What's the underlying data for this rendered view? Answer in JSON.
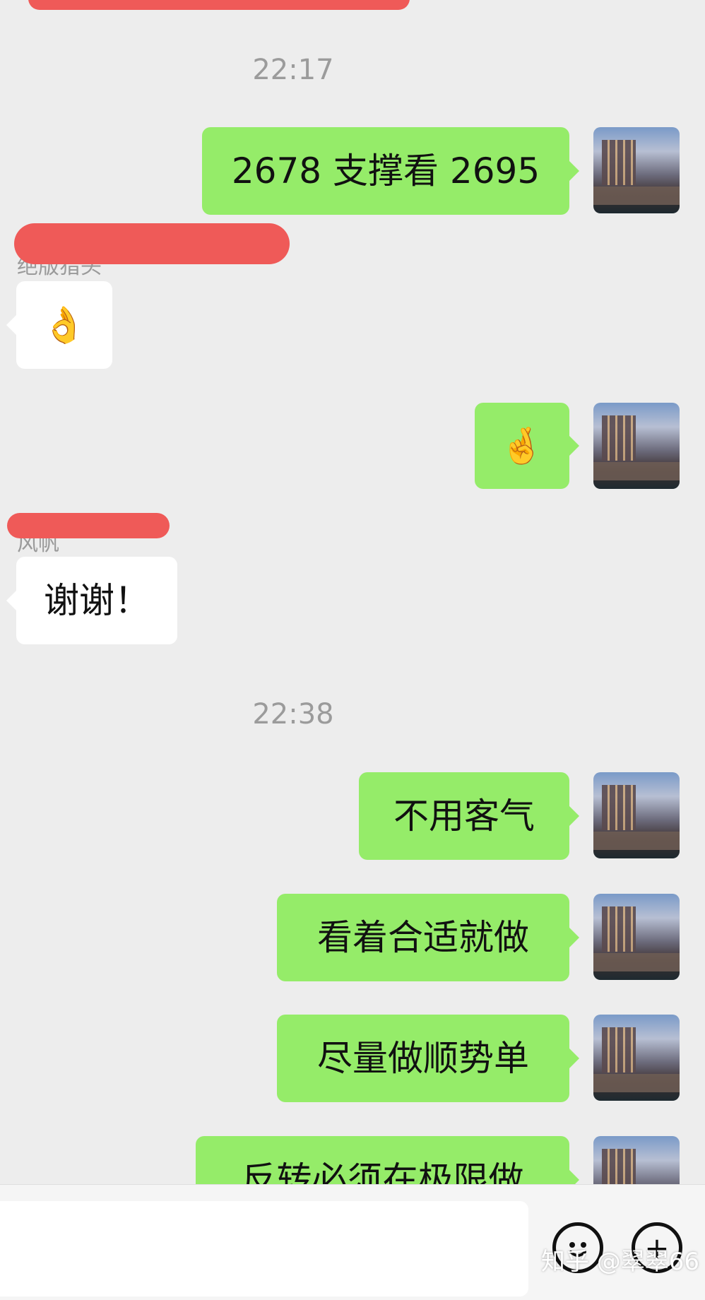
{
  "chat": {
    "times": [
      "22:17",
      "22:38"
    ],
    "messages": [
      {
        "side": "out",
        "text": "2678 支撑看 2695"
      },
      {
        "side": "in",
        "text": "👌"
      },
      {
        "side": "out",
        "text": "🤞"
      },
      {
        "side": "in",
        "text": "谢谢！"
      },
      {
        "side": "out",
        "text": "不用客气"
      },
      {
        "side": "out",
        "text": "看着合适就做"
      },
      {
        "side": "out",
        "text": "尽量做顺势单"
      },
      {
        "side": "out",
        "text": "反转必须在极限做"
      }
    ],
    "visible_name_fragments": [
      "绝版猎头",
      "风帆"
    ]
  },
  "input_bar": {
    "emoji_button_icon": "smiley-icon",
    "more_button_icon": "plus-icon",
    "more_button_glyph": "+"
  },
  "watermark": "知乎 @翠翠66",
  "colors": {
    "background": "#ededed",
    "outgoing_bubble": "#95ec69",
    "incoming_bubble": "#ffffff",
    "redaction": "#ef5a58"
  }
}
